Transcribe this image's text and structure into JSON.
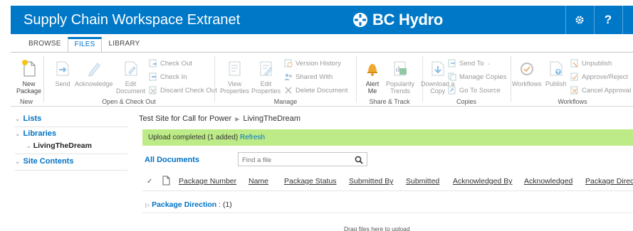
{
  "suite": {
    "title": "Supply Chain Workspace Extranet",
    "brand_name": "BC Hydro",
    "help_label": "?",
    "accent": "#0078c8"
  },
  "ribbon_tabs": [
    "BROWSE",
    "FILES",
    "LIBRARY"
  ],
  "ribbon": {
    "new": {
      "new_package": "New",
      "new_package_2": "Package",
      "group": "New"
    },
    "open": {
      "send": "Send",
      "acknowledge": "Acknowledge",
      "edit_document": "Edit",
      "edit_document_2": "Document",
      "check_out": "Check Out",
      "check_in": "Check In",
      "discard_check_out": "Discard Check Out",
      "group": "Open & Check Out"
    },
    "manage": {
      "view_properties": "View",
      "view_properties_2": "Properties",
      "edit_properties": "Edit",
      "edit_properties_2": "Properties",
      "version_history": "Version History",
      "shared_with": "Shared With",
      "delete_document": "Delete Document",
      "group": "Manage"
    },
    "share": {
      "alert_me": "Alert",
      "alert_me_2": "Me",
      "popularity_trends": "Popularity",
      "popularity_trends_2": "Trends",
      "group": "Share & Track"
    },
    "copies": {
      "download": "Download a",
      "download_2": "Copy",
      "send_to": "Send To",
      "manage_copies": "Manage Copies",
      "go_to_source": "Go To Source",
      "group": "Copies"
    },
    "workflows": {
      "workflows": "Workflows",
      "publish": "Publish",
      "unpublish": "Unpublish",
      "approve_reject": "Approve/Reject",
      "cancel_approval": "Cancel Approval",
      "group": "Workflows"
    }
  },
  "leftnav": {
    "lists": "Lists",
    "libraries": "Libraries",
    "library_item": "LivingTheDream",
    "site_contents": "Site Contents"
  },
  "breadcrumb": {
    "site": "Test Site for Call for Power",
    "page": "LivingTheDream"
  },
  "notice": {
    "text": "Upload completed (1 added)",
    "link": "Refresh"
  },
  "view": {
    "name": "All Documents",
    "search_placeholder": "Find a file"
  },
  "columns": [
    "Package Number",
    "Name",
    "Package Status",
    "Submitted By",
    "Submitted",
    "Acknowledged By",
    "Acknowledged",
    "Package Direct"
  ],
  "group_row": {
    "name": "Package Direction",
    "count": ": (1)"
  },
  "drag_hint": "Drag files here to upload"
}
